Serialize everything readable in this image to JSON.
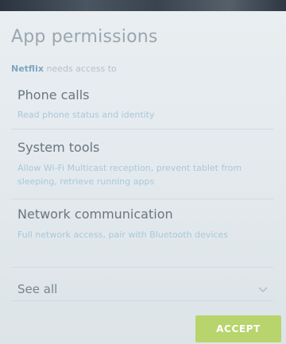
{
  "dialog": {
    "title": "App permissions",
    "app_name": "Netflix",
    "subtitle_rest": " needs access to"
  },
  "permissions": [
    {
      "title": "Phone calls",
      "description": "Read phone status and identity"
    },
    {
      "title": "System tools",
      "description": "Allow Wi-Fi Multicast reception, prevent tablet from sleeping, retrieve running apps"
    },
    {
      "title": "Network communication",
      "description": "Full network access, pair with Bluetooth devices"
    }
  ],
  "see_all": {
    "label": "See all",
    "icon": "chevron-down-icon"
  },
  "actions": {
    "accept_label": "ACCEPT"
  },
  "colors": {
    "accent": "#b8d46c",
    "app_name": "#7fa6c2",
    "description": "#a9c8da"
  }
}
